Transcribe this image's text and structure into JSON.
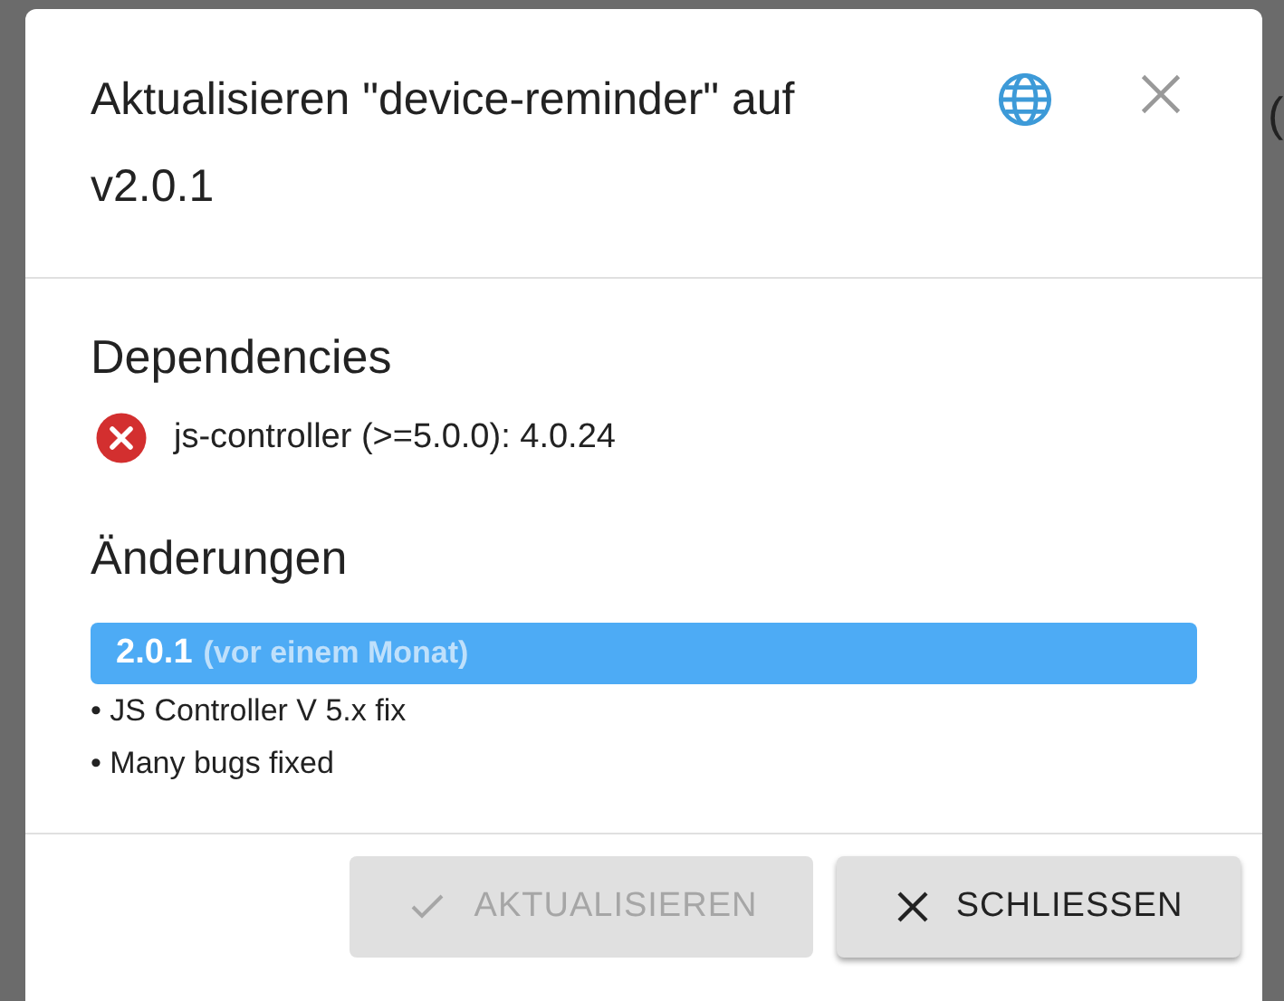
{
  "background": {
    "texts": [
      "("
    ]
  },
  "dialog": {
    "title": "Aktualisieren \"device-reminder\" auf v2.0.1",
    "dependencies": {
      "heading": "Dependencies",
      "items": [
        {
          "text": "js-controller (>=5.0.0): 4.0.24",
          "ok": false
        }
      ]
    },
    "changelog": {
      "heading": "Änderungen",
      "entries": [
        {
          "version": "2.0.1",
          "date": "(vor einem Monat)",
          "notes": [
            "• JS Controller V 5.x fix",
            "• Many bugs fixed"
          ]
        }
      ]
    },
    "buttons": [
      {
        "kind": "update",
        "label": "AKTUALISIEREN",
        "disabled": true
      },
      {
        "kind": "close",
        "label": "SCHLIESSEN",
        "disabled": false
      }
    ]
  }
}
